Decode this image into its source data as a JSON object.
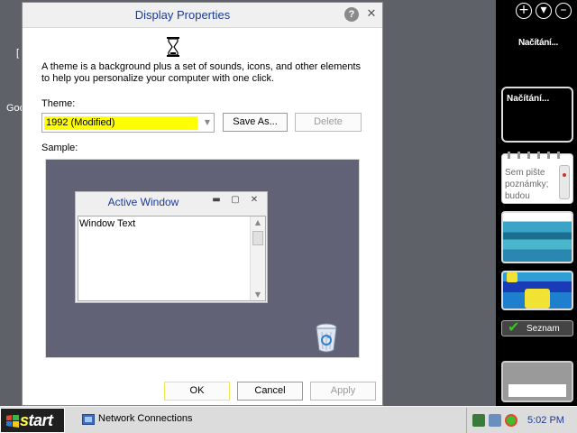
{
  "desktop": {
    "fragments": [
      "[",
      "Goo"
    ]
  },
  "sidebar": {
    "controls": [
      "+",
      "▾",
      "–"
    ],
    "headline_gadget": "Načítání...",
    "loading_gadget": "Načítání...",
    "notes_gadget": "Sem pište poznámky; budou",
    "seznam_gadget": "Seznam",
    "seznam_check": "✔"
  },
  "dialog": {
    "title": "Display Properties",
    "help_label": "?",
    "close_label": "✕",
    "description": "A theme is a background plus a set of sounds, icons, and other elements to help you personalize your computer with one click.",
    "theme_label": "Theme:",
    "theme_value": "1992 (Modified)",
    "save_as_label": "Save As...",
    "delete_label": "Delete",
    "sample_label": "Sample:",
    "sample": {
      "window_title": "Active Window",
      "window_text": "Window Text",
      "min_glyph": "▬",
      "max_glyph": "▢",
      "close_glyph": "✕"
    },
    "ok_label": "OK",
    "cancel_label": "Cancel",
    "apply_label": "Apply"
  },
  "taskbar": {
    "start_first": "s",
    "start_rest": "tart",
    "task_item": "Network Connections",
    "clock": "5:02 PM"
  },
  "colors": {
    "title_blue": "#1c3b92",
    "theme_highlight": "#ffff00",
    "desktop_bg": "#5f6169",
    "sample_bg": "#616275"
  }
}
